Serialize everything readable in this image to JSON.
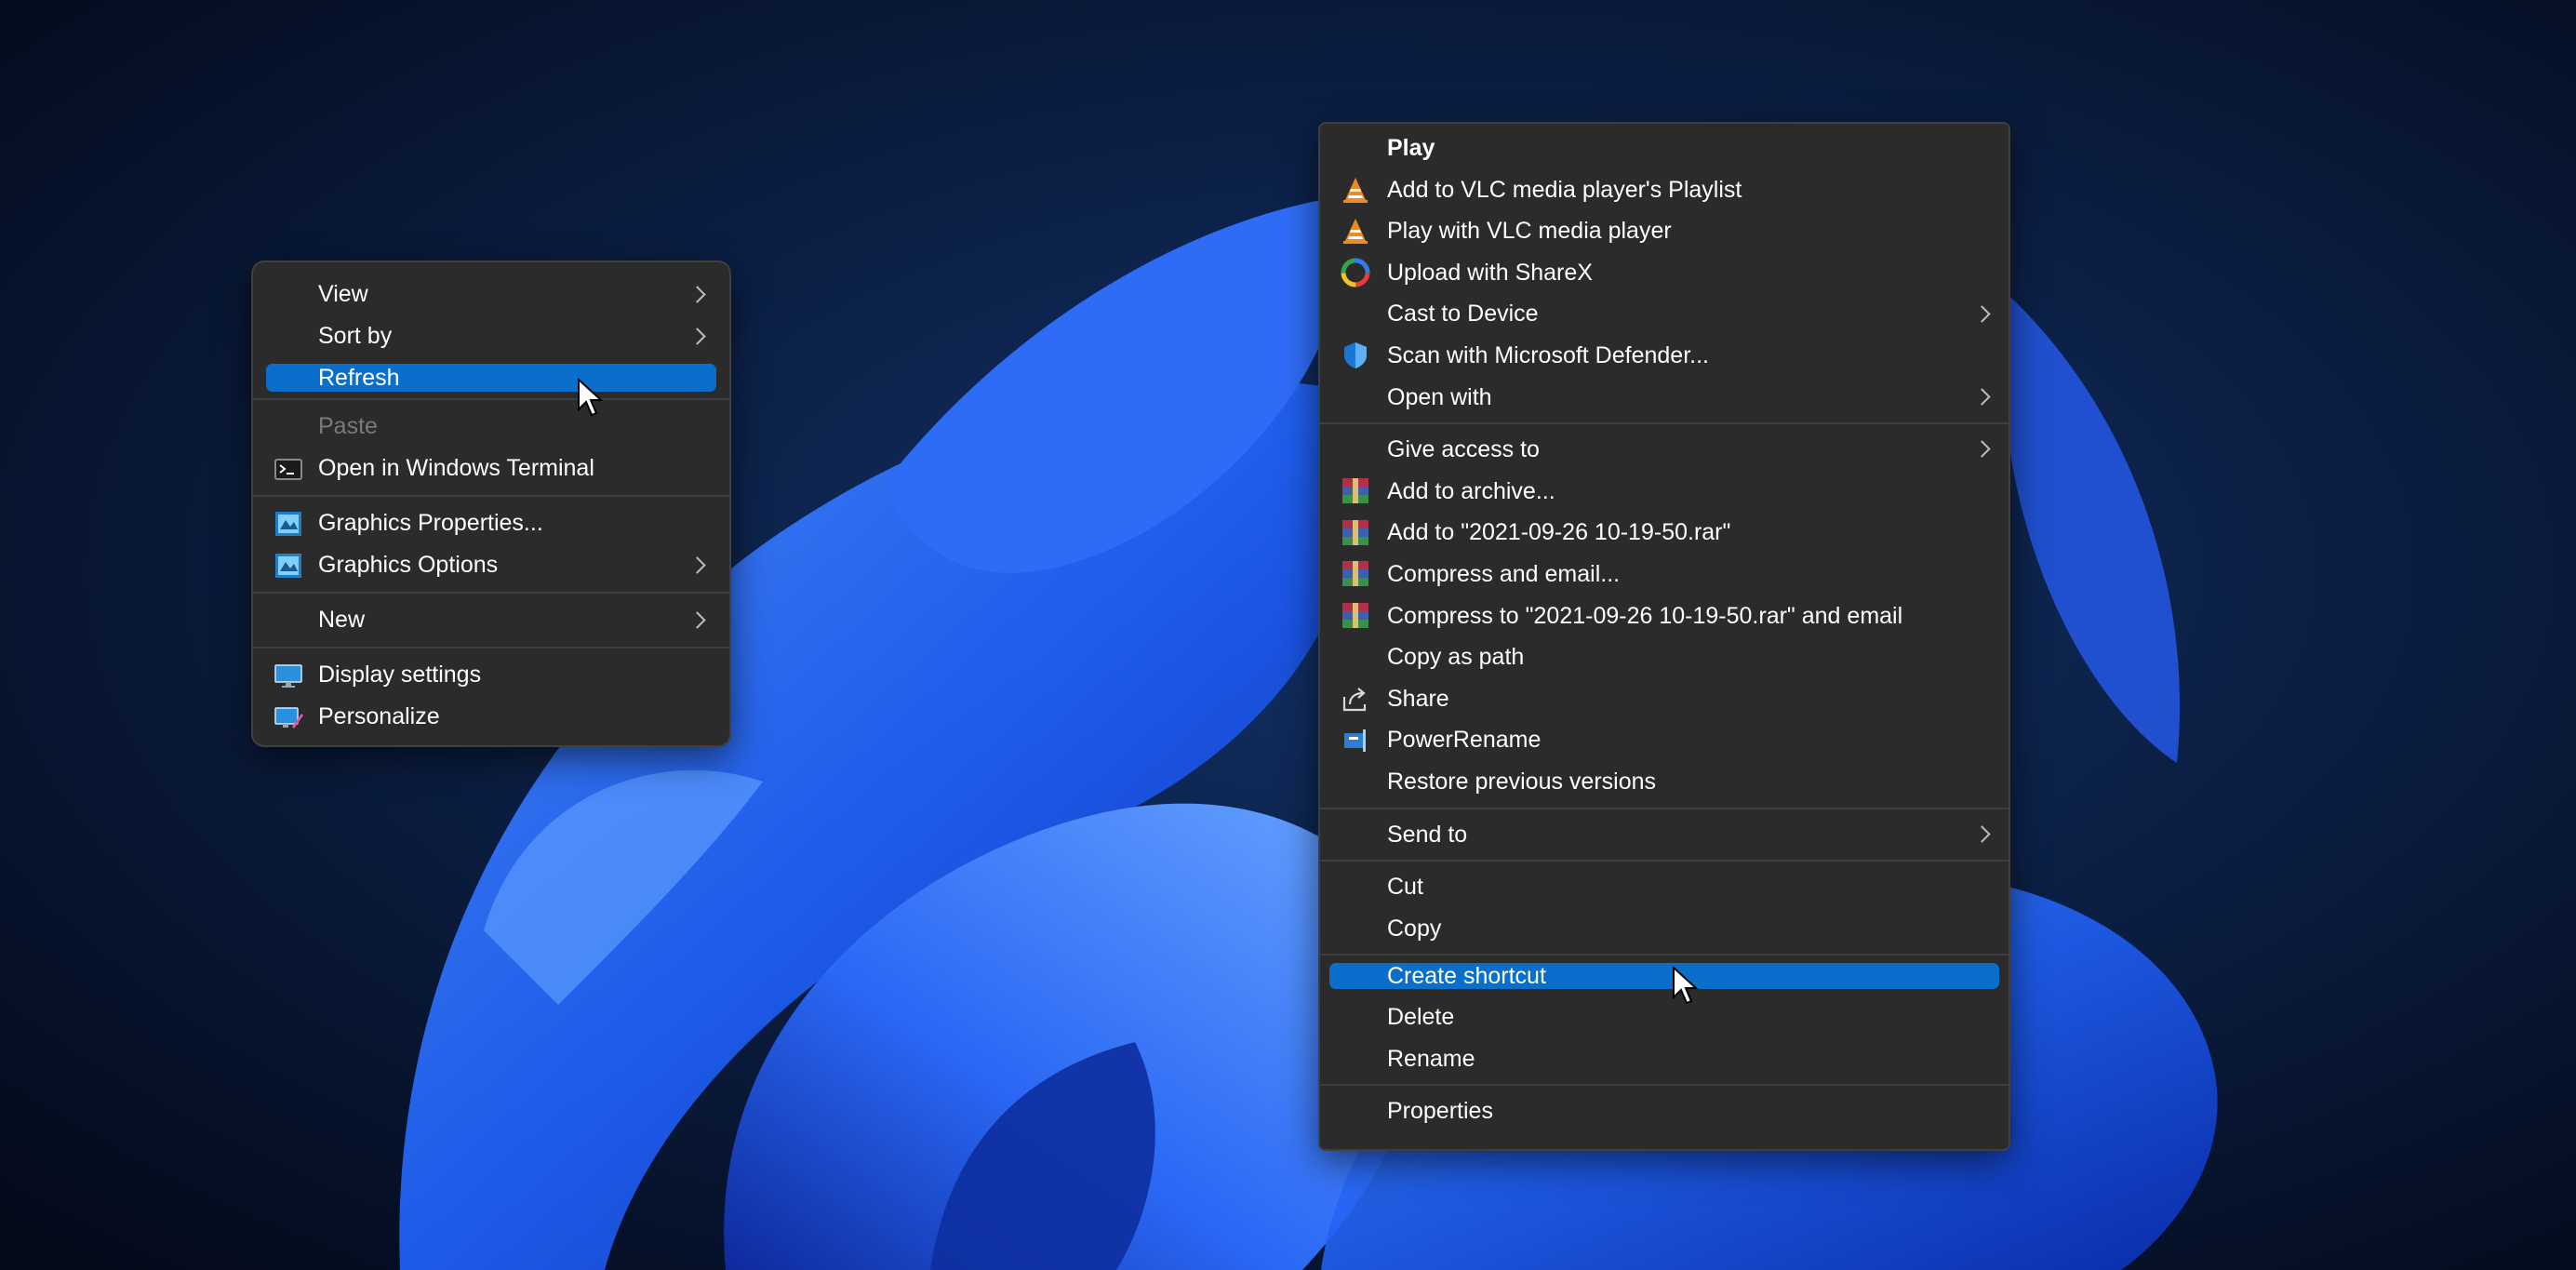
{
  "colors": {
    "menu_bg": "#2b2b2b",
    "highlight": "#0a6fcb",
    "text": "#ffffff",
    "disabled_text": "#7a7a7a",
    "wallpaper_bg": "#07152e",
    "wallpaper_bloom": "#1b5cf0"
  },
  "desktop_menu": {
    "items": [
      {
        "label": "View",
        "icon": "",
        "submenu": true
      },
      {
        "label": "Sort by",
        "icon": "",
        "submenu": true
      },
      {
        "label": "Refresh",
        "icon": "",
        "selected": true
      },
      {
        "label": "Paste",
        "icon": "",
        "disabled": true
      },
      {
        "label": "Open in Windows Terminal",
        "icon": "terminal-icon"
      },
      {
        "label": "Graphics Properties...",
        "icon": "graphics-icon"
      },
      {
        "label": "Graphics Options",
        "icon": "graphics-icon",
        "submenu": true
      },
      {
        "label": "New",
        "icon": "",
        "submenu": true
      },
      {
        "label": "Display settings",
        "icon": "display-icon"
      },
      {
        "label": "Personalize",
        "icon": "personalize-icon"
      }
    ]
  },
  "file_menu": {
    "items": [
      {
        "label": "Play",
        "icon": "",
        "bold": true
      },
      {
        "label": "Add to VLC media player's Playlist",
        "icon": "vlc-icon"
      },
      {
        "label": "Play with VLC media player",
        "icon": "vlc-icon"
      },
      {
        "label": "Upload with ShareX",
        "icon": "sharex-icon"
      },
      {
        "label": "Cast to Device",
        "icon": "",
        "submenu": true
      },
      {
        "label": "Scan with Microsoft Defender...",
        "icon": "defender-shield-icon"
      },
      {
        "label": "Open with",
        "icon": "",
        "submenu": true
      },
      {
        "label": "Give access to",
        "icon": "",
        "submenu": true
      },
      {
        "label": "Add to archive...",
        "icon": "winrar-icon"
      },
      {
        "label": "Add to \"2021-09-26 10-19-50.rar\"",
        "icon": "winrar-icon"
      },
      {
        "label": "Compress and email...",
        "icon": "winrar-icon"
      },
      {
        "label": "Compress to \"2021-09-26 10-19-50.rar\" and email",
        "icon": "winrar-icon"
      },
      {
        "label": "Copy as path",
        "icon": ""
      },
      {
        "label": "Share",
        "icon": "share-icon"
      },
      {
        "label": "PowerRename",
        "icon": "powerrename-icon"
      },
      {
        "label": "Restore previous versions",
        "icon": ""
      },
      {
        "label": "Send to",
        "icon": "",
        "submenu": true
      },
      {
        "label": "Cut",
        "icon": ""
      },
      {
        "label": "Copy",
        "icon": ""
      },
      {
        "label": "Create shortcut",
        "icon": "",
        "selected": true
      },
      {
        "label": "Delete",
        "icon": ""
      },
      {
        "label": "Rename",
        "icon": ""
      },
      {
        "label": "Properties",
        "icon": ""
      }
    ]
  }
}
